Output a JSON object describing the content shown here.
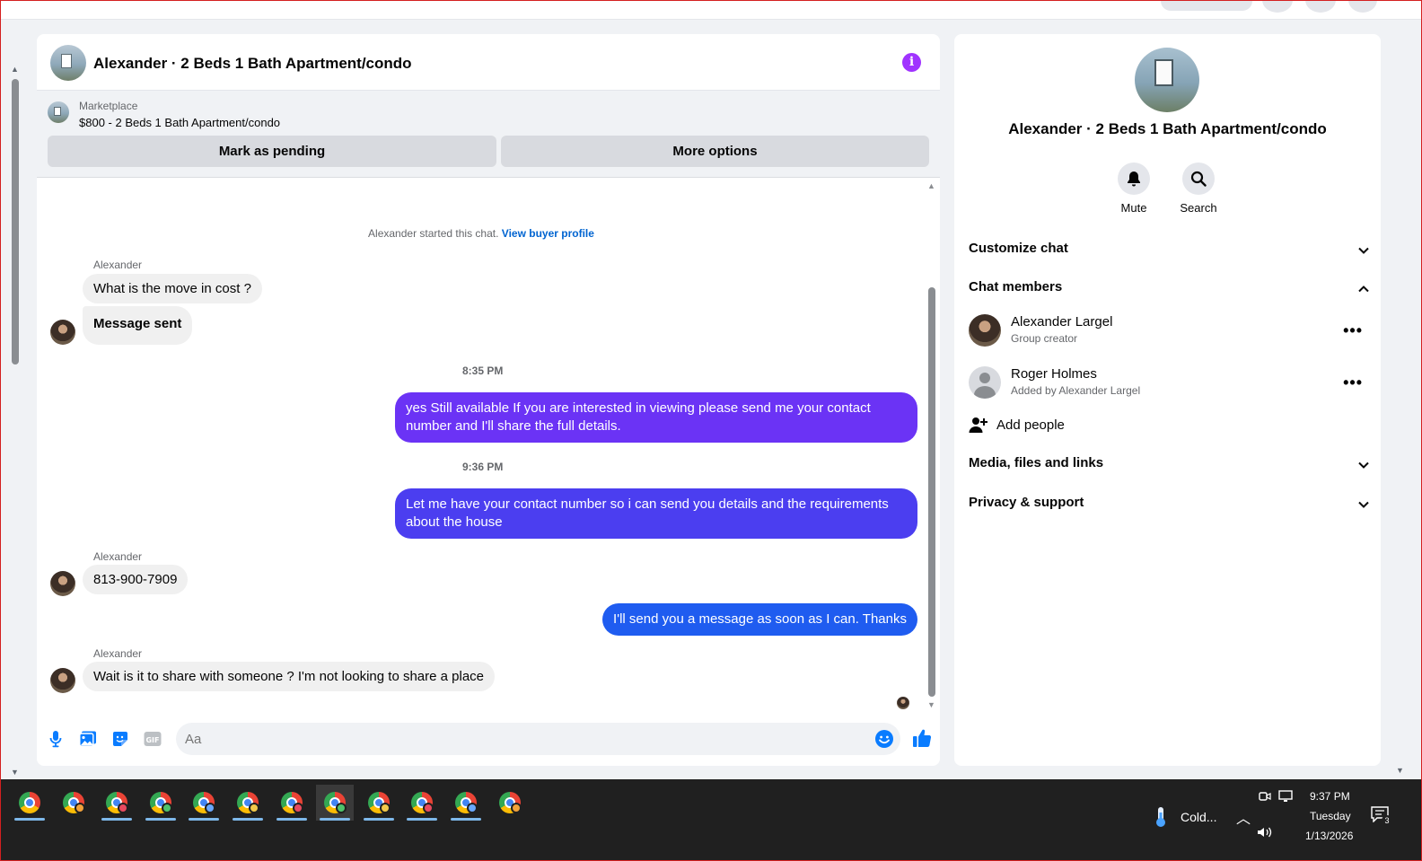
{
  "chat": {
    "title": "Alexander · 2 Beds 1 Bath Apartment/condo",
    "info_icon": "info-icon",
    "marketplace": {
      "label": "Marketplace",
      "listing": "$800 - 2 Beds 1 Bath Apartment/condo",
      "mark_pending": "Mark as pending",
      "more_options": "More options"
    },
    "system_note": {
      "text": "Alexander started this chat.",
      "link": "View buyer profile"
    },
    "messages": [
      {
        "sender": "Alexander",
        "text": "What is the move in cost ?"
      },
      {
        "text": "Message sent"
      },
      {
        "time": "8:35 PM"
      },
      {
        "text": "yes Still available If you are interested in viewing please send me your contact number and I'll share the full details."
      },
      {
        "time": "9:36 PM"
      },
      {
        "text": "Let me have your contact number so i can send you details and the requirements about the house"
      },
      {
        "sender": "Alexander",
        "text": "813-900-7909"
      },
      {
        "text": "I'll send you a message as soon as I can. Thanks"
      },
      {
        "sender": "Alexander",
        "text": "Wait is it to share with someone ? I'm not looking to share a place"
      }
    ],
    "composer": {
      "placeholder": "Aa",
      "icons": [
        "microphone-icon",
        "photo-icon",
        "sticker-icon",
        "gif-icon",
        "emoji-icon",
        "thumbs-up-icon"
      ],
      "gif_label": "GIF"
    },
    "colors": {
      "out_1": "#6b33f5",
      "out_2": "#4b3ef0",
      "out_3": "#1f5cf0",
      "incoming": "#f0f0f0",
      "accent": "#0064d1"
    }
  },
  "side": {
    "title": "Alexander · 2 Beds 1 Bath Apartment/condo",
    "actions": [
      {
        "label": "Mute",
        "icon": "bell-icon"
      },
      {
        "label": "Search",
        "icon": "search-icon"
      }
    ],
    "sections": {
      "customize": "Customize chat",
      "members": "Chat members",
      "media": "Media, files and links",
      "privacy": "Privacy & support"
    },
    "members": [
      {
        "name": "Alexander Largel",
        "role": "Group creator"
      },
      {
        "name": "Roger Holmes",
        "role": "Added by Alexander Largel"
      }
    ],
    "add_people": "Add people"
  },
  "taskbar": {
    "apps_count": 12,
    "weather": "Cold...",
    "time": "9:37 PM",
    "day": "Tuesday",
    "date": "1/13/2026",
    "notification_count": "3"
  }
}
